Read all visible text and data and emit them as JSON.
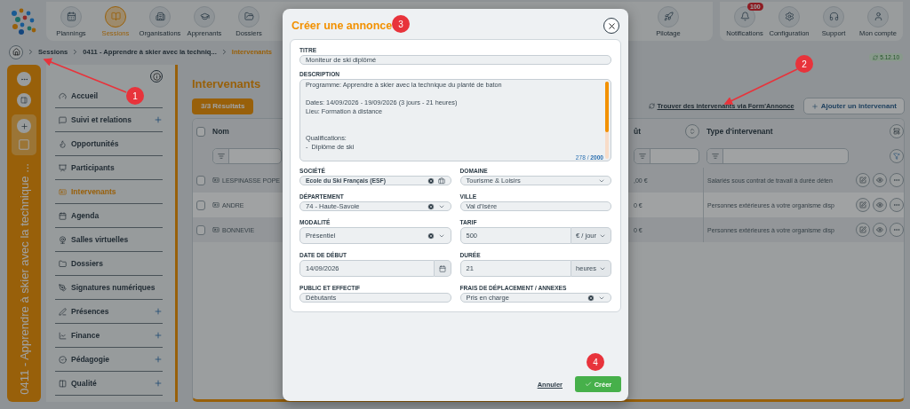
{
  "nav": {
    "items": [
      {
        "label": "Plannings",
        "selected": false
      },
      {
        "label": "Sessions",
        "selected": true
      },
      {
        "label": "Organisations",
        "selected": false
      },
      {
        "label": "Apprenants",
        "selected": false
      },
      {
        "label": "Dossiers",
        "selected": false
      }
    ],
    "end_items": [
      {
        "label": "Pilotage",
        "selected": false
      }
    ],
    "account_items": [
      {
        "label": "Notifications",
        "badge": "100"
      },
      {
        "label": "Configuration"
      },
      {
        "label": "Support"
      },
      {
        "label": "Mon compte"
      }
    ]
  },
  "breadcrumb": [
    {
      "label": "Sessions",
      "current": false
    },
    {
      "label": "0411 - Apprendre à skier avec la techniq...",
      "current": false
    },
    {
      "label": "Intervenants",
      "current": true
    }
  ],
  "version": "5.12.10",
  "session_strip": {
    "title": "0411 - Apprendre à skier avec la technique ..."
  },
  "sidebar": {
    "items": [
      {
        "label": "Accueil",
        "selected": false,
        "expandable": false
      },
      {
        "label": "Suivi et relations",
        "selected": false,
        "expandable": true
      },
      {
        "label": "Opportunités",
        "selected": false,
        "expandable": false
      },
      {
        "label": "Participants",
        "selected": false,
        "expandable": false
      },
      {
        "label": "Intervenants",
        "selected": true,
        "expandable": false
      },
      {
        "label": "Agenda",
        "selected": false,
        "expandable": false
      },
      {
        "label": "Salles virtuelles",
        "selected": false,
        "expandable": false
      },
      {
        "label": "Dossiers",
        "selected": false,
        "expandable": false
      },
      {
        "label": "Signatures numériques",
        "selected": false,
        "expandable": false
      },
      {
        "label": "Présences",
        "selected": false,
        "expandable": true
      },
      {
        "label": "Finance",
        "selected": false,
        "expandable": true
      },
      {
        "label": "Pédagogie",
        "selected": false,
        "expandable": true
      },
      {
        "label": "Qualité",
        "selected": false,
        "expandable": true
      }
    ]
  },
  "main": {
    "title": "Intervenants",
    "results": "3/3 Résultats",
    "find_link": "Trouver des intervenants via Form'Annonce",
    "add_button": "Ajouter un intervenant",
    "table": {
      "columns": [
        "Nom",
        "ût",
        "Type d'intervenant"
      ],
      "all_checked": false,
      "rows": [
        {
          "name": "LESPINASSE POPE",
          "cost": ",00 €",
          "type": "Salariés sous contrat de travail à durée déten",
          "checked": false
        },
        {
          "name": "ANDRE",
          "cost": "0 €",
          "type": "Personnes extérieures à votre organisme disp",
          "checked": false
        },
        {
          "name": "BONNEVIE",
          "cost": "0 €",
          "type": "Personnes extérieures à votre organisme disp",
          "checked": false
        }
      ]
    }
  },
  "modal": {
    "title": "Créer une annonce",
    "title_field": {
      "label": "TITRE",
      "value": "Moniteur de ski diplômé"
    },
    "description": {
      "label": "DESCRIPTION",
      "value": "Programme: Apprendre à skier avec la technique du planté de baton\n\nDates: 14/09/2026 - 19/09/2026 (3 jours - 21 heures)\nLieu: Formation à distance\n\n\nQualifications:\n-  Diplôme de ski",
      "counter": "278 / **2000**"
    },
    "fields": [
      {
        "label": "SOCIÉTÉ",
        "kind": "company",
        "value": "Ecole du Ski Français (ESF)",
        "clearable": true
      },
      {
        "label": "DOMAINE",
        "kind": "select",
        "value": "Tourisme & Loisirs",
        "clearable": false
      },
      {
        "label": "DÉPARTEMENT",
        "kind": "select",
        "value": "74 - Haute-Savoie",
        "clearable": true
      },
      {
        "label": "VILLE",
        "kind": "text",
        "value": "Val d'Isère"
      },
      {
        "label": "MODALITÉ",
        "kind": "select",
        "value": "Présentiel",
        "clearable": true
      },
      {
        "label": "TARIF",
        "kind": "unit",
        "value": "500",
        "unit": "€ / jour"
      },
      {
        "label": "DATE DE DÉBUT",
        "kind": "date",
        "value": "14/09/2026"
      },
      {
        "label": "DURÉE",
        "kind": "unit",
        "value": "21",
        "unit": "heures"
      },
      {
        "label": "PUBLIC ET EFFECTIF",
        "kind": "text",
        "value": "Débutants"
      },
      {
        "label": "FRAIS DE DÉPLACEMENT / ANNEXES",
        "kind": "select",
        "value": "Pris en charge",
        "clearable": true
      }
    ],
    "cancel": "Annuler",
    "submit": "Créer"
  },
  "annotations": [
    {
      "number": "1",
      "arrow": true
    },
    {
      "number": "2",
      "arrow": true
    },
    {
      "number": "3",
      "arrow": false
    },
    {
      "number": "4",
      "arrow": false
    }
  ]
}
